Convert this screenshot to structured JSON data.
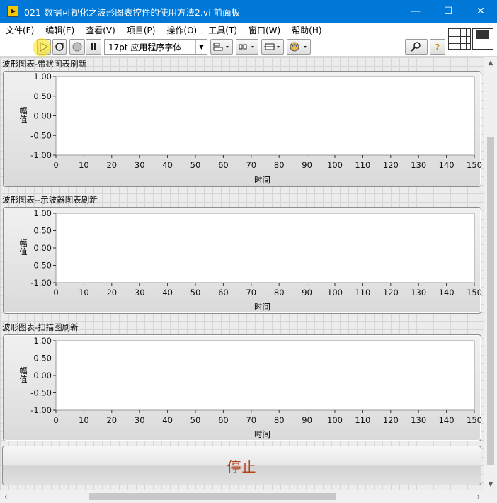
{
  "window": {
    "title": "021-数据可视化之波形图表控件的使用方法2.vi 前面板",
    "minimize": "—",
    "maximize": "☐",
    "close": "✕"
  },
  "menu": [
    "文件(F)",
    "编辑(E)",
    "查看(V)",
    "项目(P)",
    "操作(O)",
    "工具(T)",
    "窗口(W)",
    "帮助(H)"
  ],
  "toolbar": {
    "font_select": "17pt 应用程序字体",
    "run_icon": "run-arrow-icon",
    "run_continuous_icon": "run-continuously-icon",
    "abort_icon": "abort-icon",
    "pause_icon": "pause-icon",
    "search_icon": "search-icon",
    "help_icon": "help-icon",
    "help_label": "?"
  },
  "charts": [
    {
      "label": "波形图表-带状图表刷新",
      "y_title": "幅值",
      "x_title": "时间"
    },
    {
      "label": "波形图表--示波器图表刷新",
      "y_title": "幅值",
      "x_title": "时间"
    },
    {
      "label": "波形图表-扫描图刷新",
      "y_title": "幅值",
      "x_title": "时间"
    }
  ],
  "chart_data": [
    {
      "type": "line",
      "title": "",
      "xlabel": "时间",
      "ylabel": "幅值",
      "xlim": [
        0,
        150
      ],
      "ylim": [
        -1.0,
        1.0
      ],
      "x_ticks": [
        "0",
        "10",
        "20",
        "30",
        "40",
        "50",
        "60",
        "70",
        "80",
        "90",
        "100",
        "110",
        "120",
        "130",
        "140",
        "150"
      ],
      "y_ticks": [
        "1.00",
        "0.50",
        "0.00",
        "-0.50",
        "-1.00"
      ],
      "series": []
    },
    {
      "type": "line",
      "title": "",
      "xlabel": "时间",
      "ylabel": "幅值",
      "xlim": [
        0,
        150
      ],
      "ylim": [
        -1.0,
        1.0
      ],
      "x_ticks": [
        "0",
        "10",
        "20",
        "30",
        "40",
        "50",
        "60",
        "70",
        "80",
        "90",
        "100",
        "110",
        "120",
        "130",
        "140",
        "150"
      ],
      "y_ticks": [
        "1.00",
        "0.50",
        "0.00",
        "-0.50",
        "-1.00"
      ],
      "series": []
    },
    {
      "type": "line",
      "title": "",
      "xlabel": "时间",
      "ylabel": "幅值",
      "xlim": [
        0,
        150
      ],
      "ylim": [
        -1.0,
        1.0
      ],
      "x_ticks": [
        "0",
        "10",
        "20",
        "30",
        "40",
        "50",
        "60",
        "70",
        "80",
        "90",
        "100",
        "110",
        "120",
        "130",
        "140",
        "150"
      ],
      "y_ticks": [
        "1.00",
        "0.50",
        "0.00",
        "-0.50",
        "-1.00"
      ],
      "series": []
    }
  ],
  "stop_button": {
    "label": "停止",
    "color": "#b5421b"
  },
  "colors": {
    "title_bar": "#0078d7",
    "plot_area": "#ffffff",
    "canvas_grid": "#d6d6d6"
  }
}
